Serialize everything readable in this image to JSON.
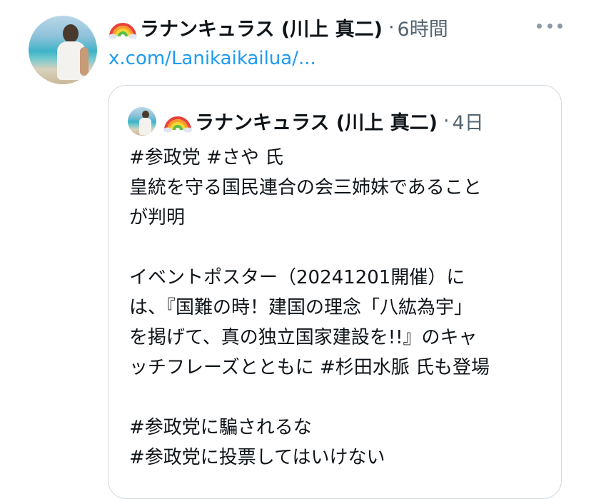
{
  "tweet": {
    "author": {
      "display_name": "ラナンキュラス (川上 真二)",
      "emoji": "🌈",
      "avatar_icon": "profile-photo-icon"
    },
    "separator": "·",
    "time_ago": "6時間",
    "more_icon": "more-horizontal-icon",
    "link_text": "x.com/Lanikaikailua/..."
  },
  "quoted_tweet": {
    "author": {
      "display_name": "ラナンキュラス (川上 真二)",
      "emoji": "🌈",
      "avatar_icon": "profile-photo-icon"
    },
    "separator": "·",
    "time_ago": "4日",
    "lines": [
      "#参政党 #さや 氏",
      "皇統を守る国民連合の会三姉妹であること",
      "が判明",
      "",
      "イベントポスター（20241201開催）に",
      "は、『国難の時！建国の理念「八紘為宇」",
      "を掲げて、真の独立国家建設を!!』のキャ",
      "ッチフレーズとともに #杉田水脈 氏も登場",
      "",
      "#参政党に騙されるな",
      "#参政党に投票してはいけない"
    ]
  },
  "colors": {
    "link": "#1d9bf0",
    "secondary_text": "#536471",
    "primary_text": "#0f1419",
    "card_border": "#cfd9de"
  }
}
